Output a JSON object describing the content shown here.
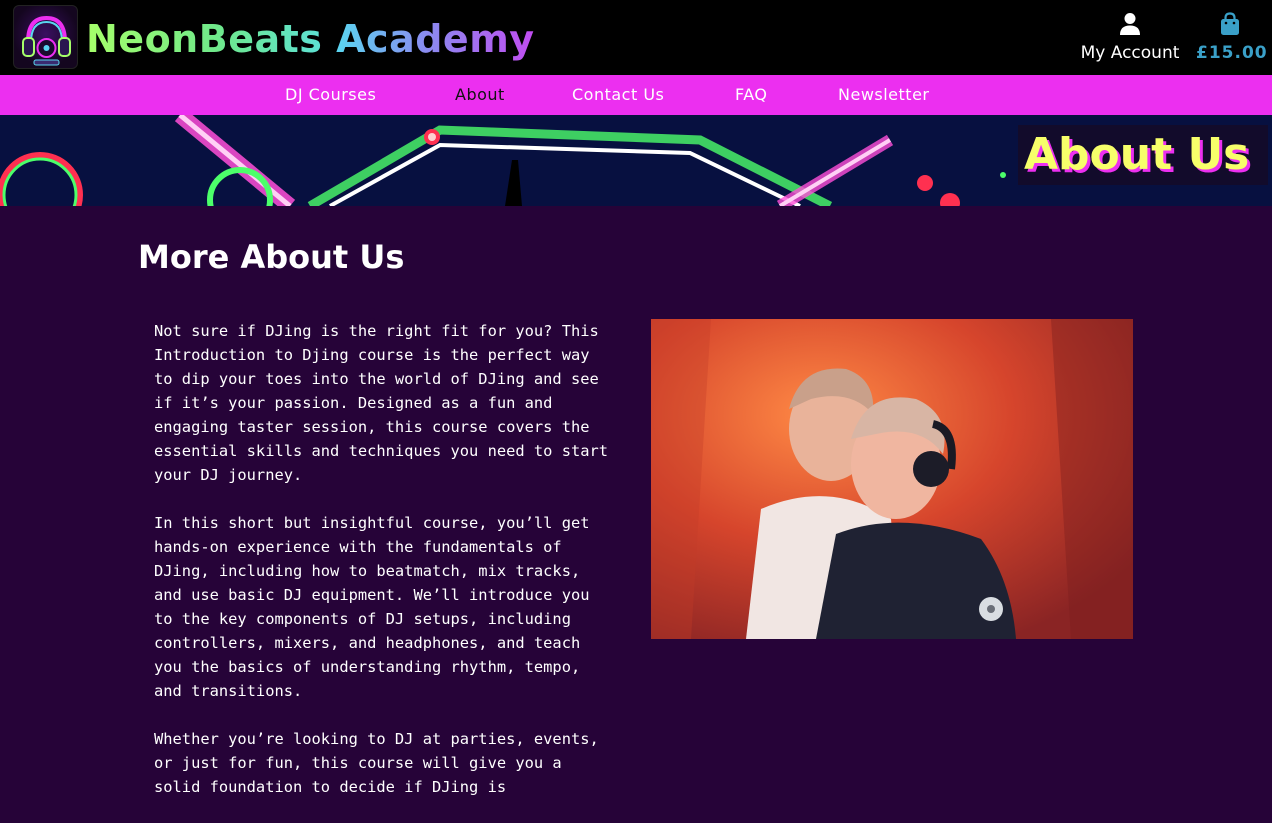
{
  "brand": {
    "part1": "NeonBeats",
    "part2": "Academy"
  },
  "header": {
    "account_label": "My Account",
    "account_icon": "user-icon",
    "bag_total": "£15.00",
    "bag_icon": "shopping-bag-icon"
  },
  "nav": {
    "items": [
      {
        "label": "DJ Courses"
      },
      {
        "label": "About"
      },
      {
        "label": "Contact Us"
      },
      {
        "label": "FAQ"
      },
      {
        "label": "Newsletter"
      }
    ],
    "active": "About"
  },
  "banner": {
    "title": "About Us"
  },
  "main": {
    "heading": "More About Us",
    "paragraphs": [
      "Not sure if DJing is the right fit for you? This Introduction to Djing course is the perfect way to dip your toes into the world of DJing and see if it’s your passion. Designed as a fun and engaging taster session, this course covers the essential skills and techniques you need to start your DJ journey.",
      "In this short but insightful course, you’ll get hands-on experience with the fundamentals of DJing, including how to beatmatch, mix tracks, and use basic DJ equipment. We’ll introduce you to the key components of DJ setups, including controllers, mixers, and headphones, and teach you the basics of understanding rhythm, tempo, and transitions.",
      "Whether you’re looking to DJ at parties, events, or just for fun, this course will give you a solid foundation to decide if DJing is"
    ]
  },
  "colors": {
    "page_bg": "#260338",
    "nav_bg": "#ec2ff0",
    "header_bg": "#000000",
    "bag_total": "#3aa0c8",
    "banner_title": "#f7ff6a"
  }
}
